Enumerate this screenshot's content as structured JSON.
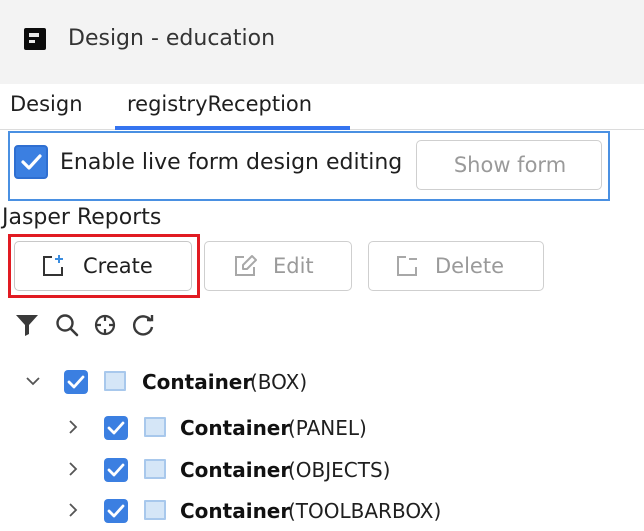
{
  "window": {
    "title": "Design - education",
    "app_icon": "intellij-idea-icon"
  },
  "tabs": [
    {
      "label": "Design",
      "active": false
    },
    {
      "label": "registryReception",
      "active": true
    }
  ],
  "live_edit": {
    "checked": true,
    "label": "Enable live form design editing",
    "show_form_label": "Show form",
    "show_form_enabled": false
  },
  "section": {
    "label": "Jasper Reports"
  },
  "actions": {
    "create_label": "Create",
    "edit_label": "Edit",
    "delete_label": "Delete",
    "create_icon": "create-report-icon",
    "edit_icon": "edit-report-icon",
    "delete_icon": "delete-report-icon"
  },
  "toolbar": {
    "icons": [
      "filter-icon",
      "search-icon",
      "locate-icon",
      "refresh-icon"
    ]
  },
  "tree": [
    {
      "name": "Container",
      "type": "(BOX)",
      "level": 0,
      "expanded": true,
      "checked": true
    },
    {
      "name": "Container",
      "type": "(PANEL)",
      "level": 1,
      "expanded": false,
      "checked": true
    },
    {
      "name": "Container",
      "type": "(OBJECTS)",
      "level": 1,
      "expanded": false,
      "checked": true
    },
    {
      "name": "Container",
      "type": "(TOOLBARBOX)",
      "level": 1,
      "expanded": false,
      "checked": true
    }
  ],
  "colors": {
    "accent": "#3574f0",
    "checkbox": "#3b7fe1",
    "highlight": "#e11b22",
    "frame": "#4a90e2"
  }
}
